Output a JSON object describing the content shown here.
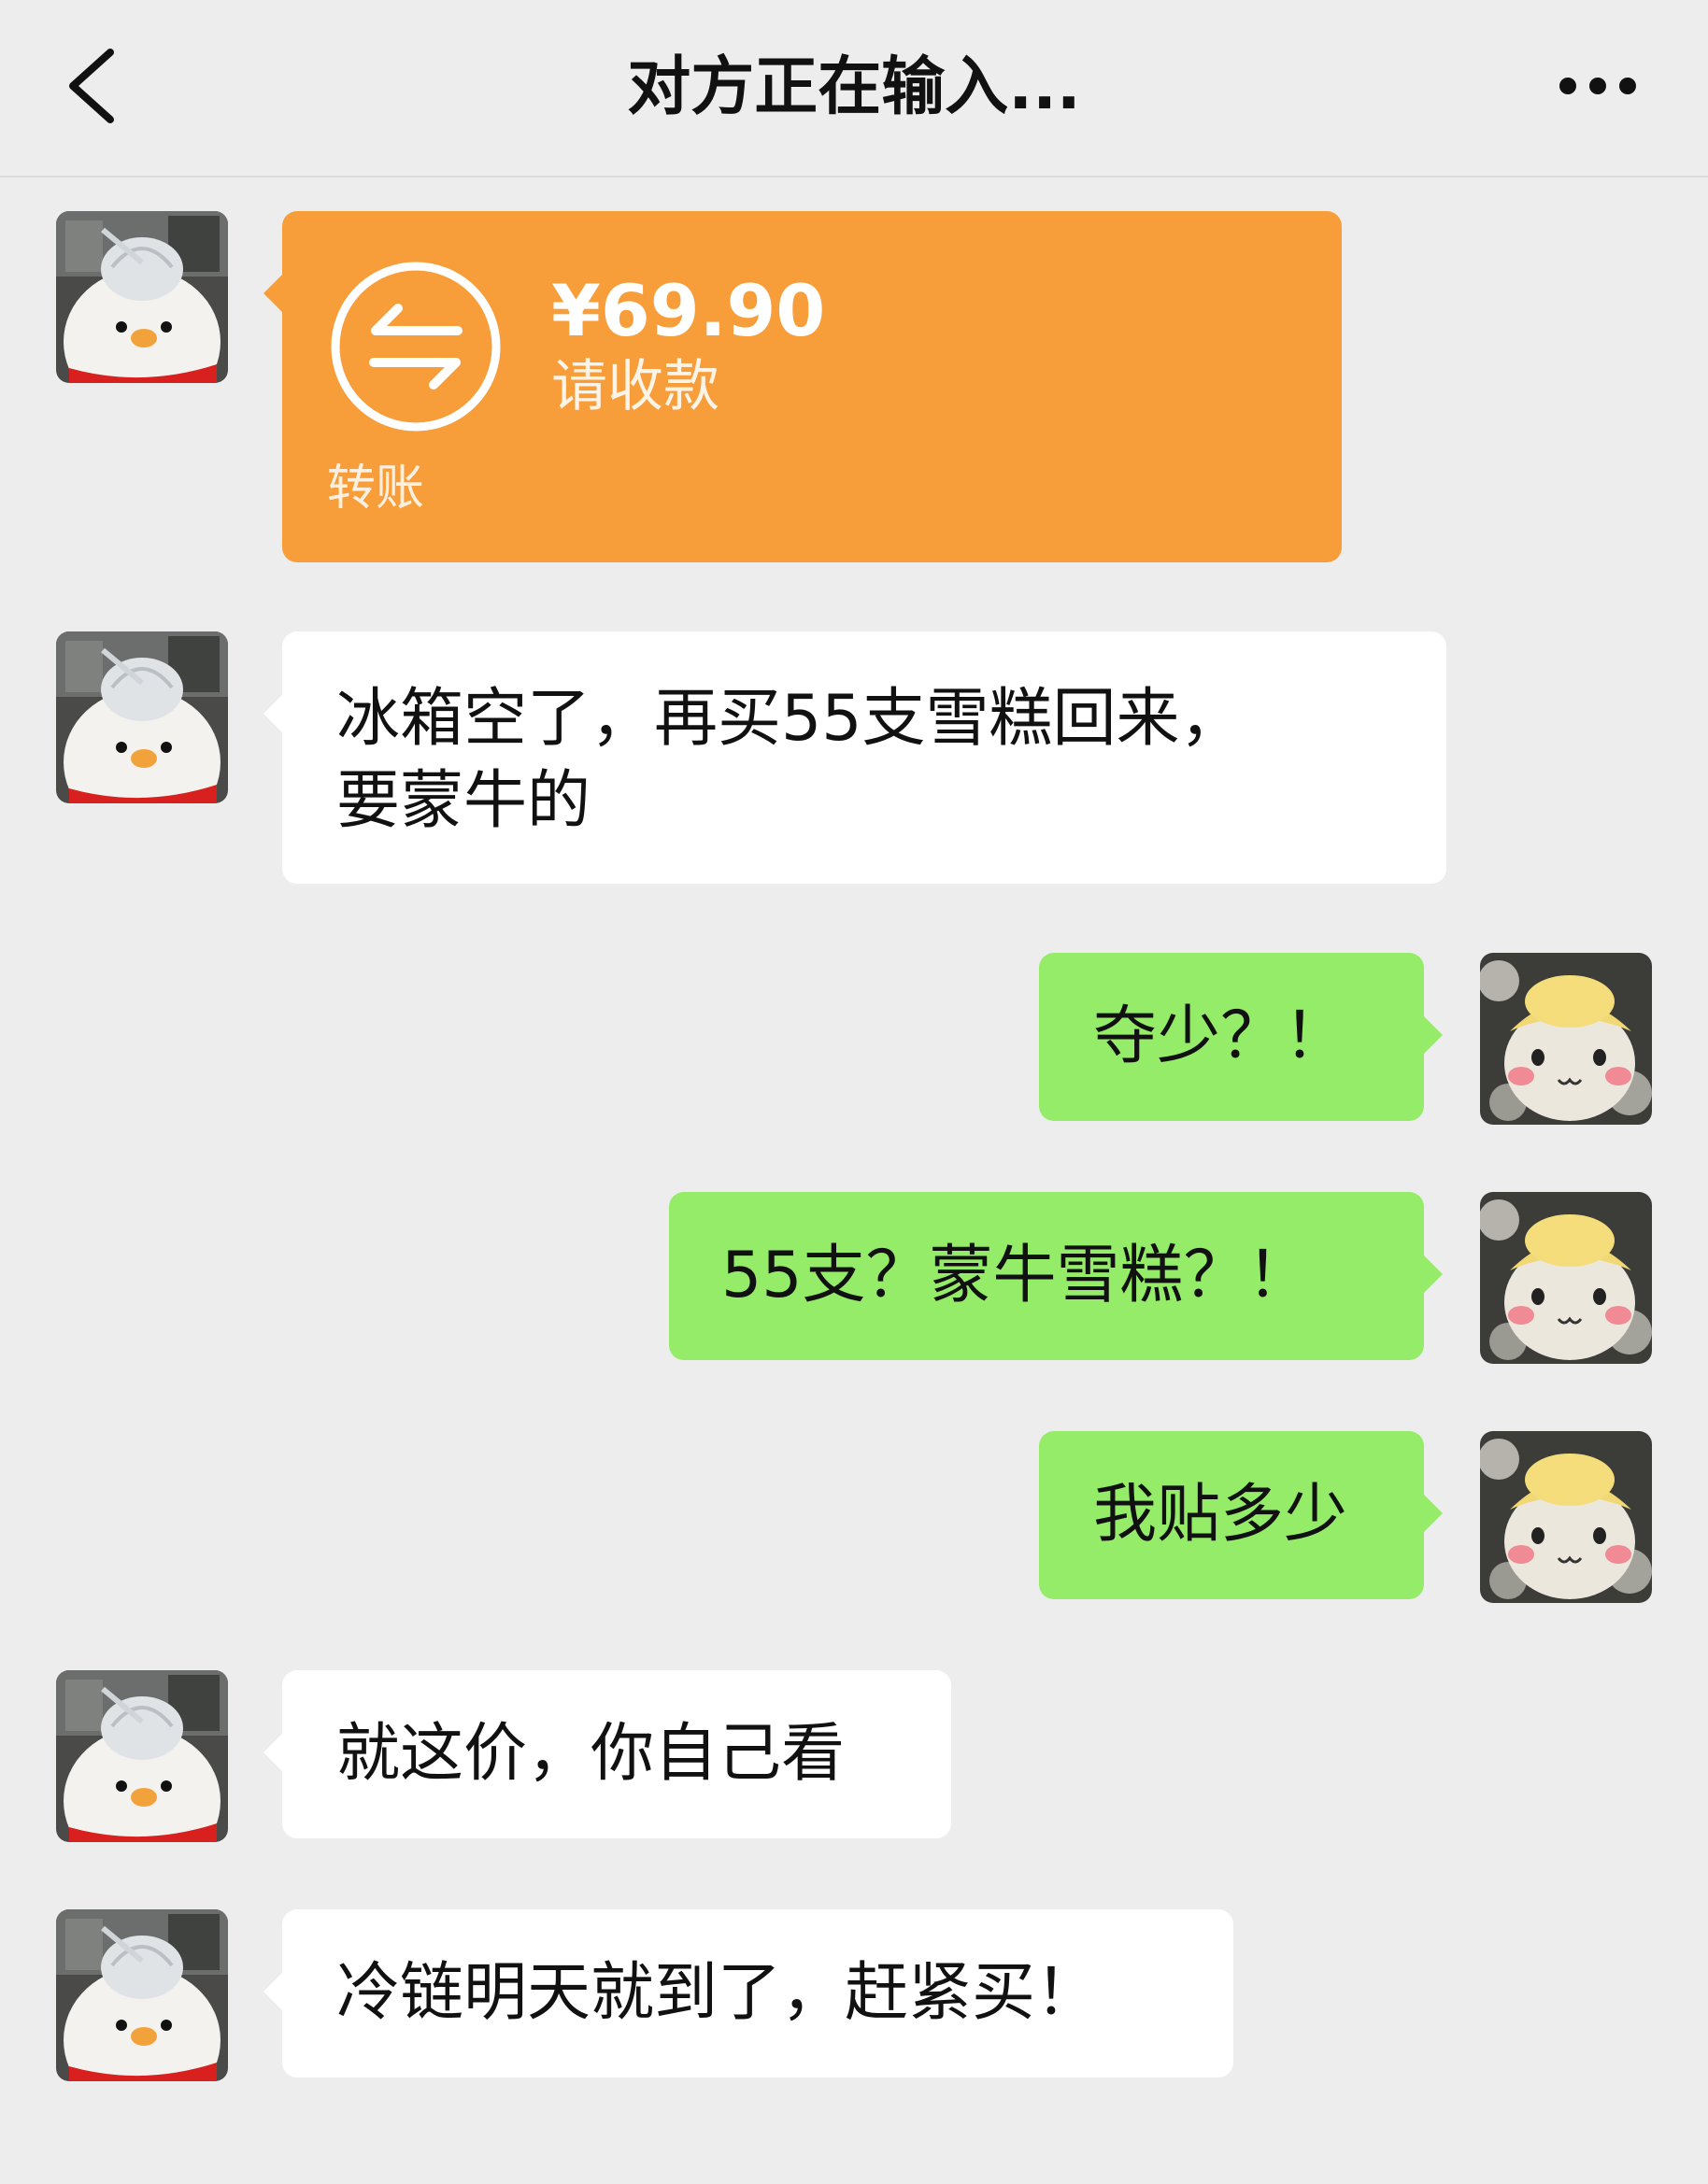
{
  "header": {
    "title": "对方正在输入..."
  },
  "transfer": {
    "amount": "¥69.90",
    "status": "请收款",
    "label": "转账"
  },
  "messages": [
    {
      "from": "them",
      "text_line1": "冰箱空了，再买55支雪糕回来，",
      "text_line2": "要蒙牛的"
    },
    {
      "from": "me",
      "text": "夺少？！"
    },
    {
      "from": "me",
      "text": "55支？蒙牛雪糕？！"
    },
    {
      "from": "me",
      "text": "我贴多少"
    },
    {
      "from": "them",
      "text": "就这价，你自己看"
    },
    {
      "from": "them",
      "text": "冷链明天就到了，赶紧买！"
    }
  ],
  "colors": {
    "background": "#ededed",
    "bubble_self": "#95ec69",
    "bubble_other": "#ffffff",
    "transfer_card": "#f79e3b"
  },
  "icons": {
    "back": "chevron-left-icon",
    "more": "more-dots-icon",
    "transfer": "transfer-arrows-icon",
    "avatar_other": "duck-avatar",
    "avatar_self": "plush-avatar"
  }
}
